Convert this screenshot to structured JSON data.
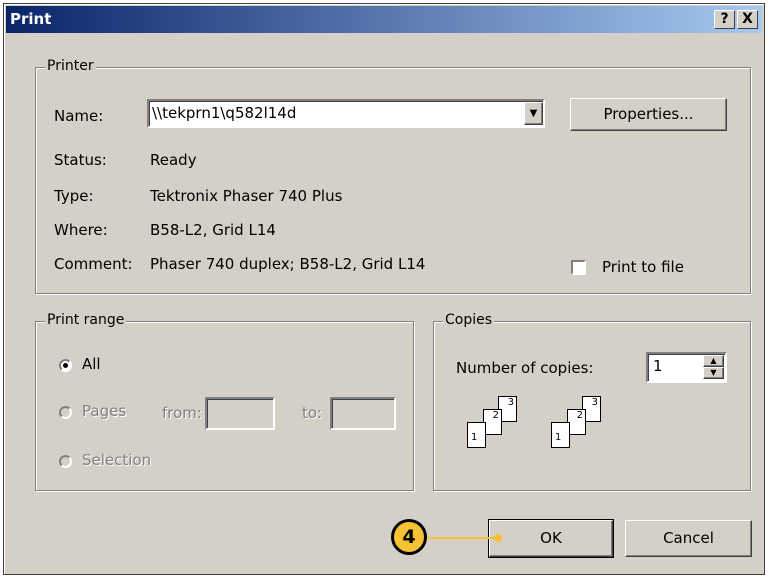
{
  "window": {
    "title": "Print",
    "help_button": "?",
    "close_button": "X"
  },
  "printer": {
    "legend": "Printer",
    "name_label": "Name:",
    "name_value": "\\\\tekprn1\\q582l14d",
    "properties_button": "Properties...",
    "status_label": "Status:",
    "status_value": "Ready",
    "type_label": "Type:",
    "type_value": "Tektronix Phaser 740 Plus",
    "where_label": "Where:",
    "where_value": "B58-L2, Grid L14",
    "comment_label": "Comment:",
    "comment_value": "Phaser 740 duplex; B58-L2, Grid L14",
    "print_to_file_label": "Print to file",
    "print_to_file_checked": false
  },
  "print_range": {
    "legend": "Print range",
    "all_label": "All",
    "pages_label": "Pages",
    "from_label": "from:",
    "to_label": "to:",
    "selection_label": "Selection",
    "selected": "All"
  },
  "copies": {
    "legend": "Copies",
    "number_label": "Number of copies:",
    "number_value": "1",
    "collate_icon_pages": [
      "1",
      "2",
      "3"
    ]
  },
  "actions": {
    "ok_button": "OK",
    "cancel_button": "Cancel"
  },
  "callout": {
    "number": "4",
    "color": "#f6c233"
  }
}
